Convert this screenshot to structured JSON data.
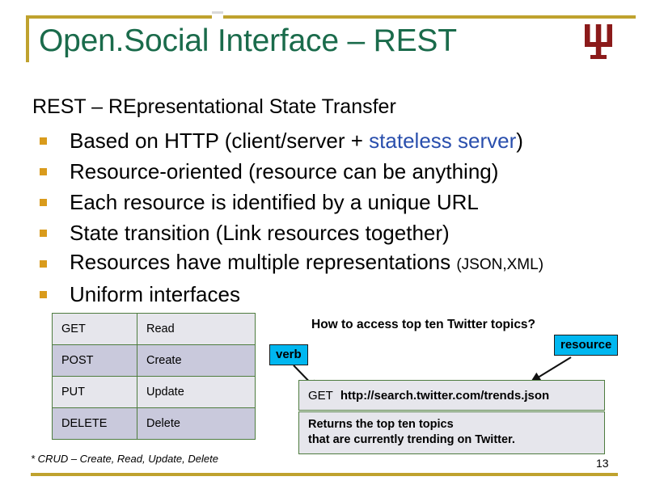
{
  "slide": {
    "title": "Open.Social Interface – REST",
    "lead_line": "REST – REpresentational State Transfer",
    "logo_name": "indiana-university-trident-logo",
    "page_number": "13",
    "footnote": "* CRUD – Create, Read, Update, Delete"
  },
  "bullets": [
    {
      "text_before": "Based on HTTP (client/server + ",
      "accent": "stateless server",
      "text_after": ")",
      "small": ""
    },
    {
      "text_before": "Resource-oriented (resource can be anything)",
      "accent": "",
      "text_after": "",
      "small": ""
    },
    {
      "text_before": "Each resource is identified by a unique URL",
      "accent": "",
      "text_after": "",
      "small": ""
    },
    {
      "text_before": "State transition (Link resources together)",
      "accent": "",
      "text_after": "",
      "small": ""
    },
    {
      "text_before": "Resources have multiple representations ",
      "accent": "",
      "text_after": "",
      "small": "(JSON,XML)"
    },
    {
      "text_before": "Uniform interfaces",
      "accent": "",
      "text_after": "",
      "small": ""
    }
  ],
  "verb_table": {
    "rows": [
      {
        "verb": "GET",
        "action": "Read"
      },
      {
        "verb": "POST",
        "action": "Create"
      },
      {
        "verb": "PUT",
        "action": "Update"
      },
      {
        "verb": "DELETE",
        "action": "Delete"
      }
    ]
  },
  "example": {
    "question": "How to access top ten Twitter topics?",
    "chip_verb": "verb",
    "chip_resource": "resource",
    "request_verb": "GET",
    "request_url": "http://search.twitter.com/trends.json",
    "response_line_1": "Returns the top ten topics",
    "response_line_2": "that are currently trending on Twitter."
  },
  "colors": {
    "gold_rule": "#bfa22e",
    "title_green": "#1a6b4b",
    "bullet_marker": "#d99b1c",
    "accent_blue": "#2a4fad",
    "chip_cyan": "#00b7f0",
    "table_border_green": "#4e7c3f",
    "row_light": "#e6e6ec",
    "row_dark": "#c9c9dc",
    "logo_crimson": "#8b1a1a"
  }
}
